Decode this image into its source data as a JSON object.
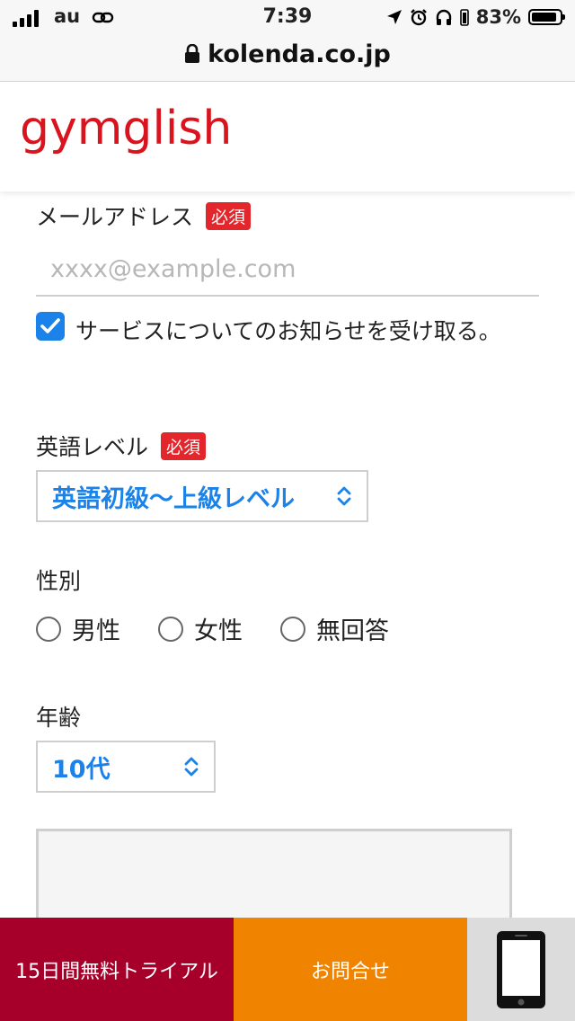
{
  "status_bar": {
    "carrier": "au",
    "time": "7:39",
    "battery": "83%"
  },
  "browser": {
    "url": "kolenda.co.jp"
  },
  "header": {
    "logo": "gymglish"
  },
  "form": {
    "email": {
      "label": "メールアドレス",
      "required": "必須",
      "placeholder": "xxxx@example.com",
      "value": ""
    },
    "newsletter": {
      "checked": true,
      "label": "サービスについてのお知らせを受け取る。"
    },
    "english_level": {
      "label": "英語レベル",
      "required": "必須",
      "selected": "英語初級〜上級レベル"
    },
    "gender": {
      "label": "性別",
      "options": [
        "男性",
        "女性",
        "無回答"
      ]
    },
    "age": {
      "label": "年齢",
      "selected": "10代"
    }
  },
  "bottom_bar": {
    "trial_label": "15日間無料トライアル",
    "contact_label": "お問合せ",
    "phone_icon": "smartphone-icon"
  },
  "colors": {
    "brand_red": "#d9141e",
    "required_red": "#e3262b",
    "accent_blue": "#1a82e8",
    "trial_bg": "#a6002a",
    "contact_bg": "#f08300"
  }
}
